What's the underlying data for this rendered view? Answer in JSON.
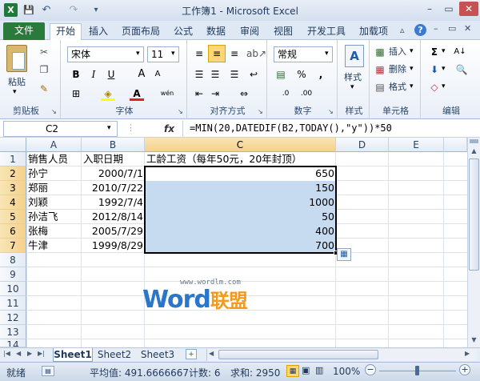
{
  "window": {
    "title": "工作簿1 - Microsoft Excel",
    "min": "–",
    "max": "▭",
    "close": "✕"
  },
  "qat": {
    "save": "💾",
    "undo": "↶",
    "redo": "↷",
    "more": "▾"
  },
  "tabs": {
    "file": "文件",
    "items": [
      "开始",
      "插入",
      "页面布局",
      "公式",
      "数据",
      "审阅",
      "视图",
      "开发工具",
      "加载项"
    ],
    "help": "?",
    "min_ribbon": "▵"
  },
  "ribbon": {
    "clipboard": {
      "label": "剪贴板",
      "paste": "粘贴"
    },
    "font": {
      "label": "字体",
      "name": "宋体",
      "size": "11",
      "bold": "B",
      "italic": "I",
      "underline": "U",
      "grow": "A",
      "shrink": "A",
      "wen": "wén"
    },
    "alignment": {
      "label": "对齐方式"
    },
    "number": {
      "label": "数字",
      "format": "常规",
      "percent": "%",
      "comma": ",",
      "currency": "⁰⁰",
      "inc": ".0",
      "dec": ".00"
    },
    "styles": {
      "label": "样式",
      "style": "样式"
    },
    "cells": {
      "label": "单元格",
      "insert": "插入",
      "delete": "删除",
      "format": "格式"
    },
    "editing": {
      "label": "编辑",
      "sum": "Σ",
      "sort": "A↓"
    }
  },
  "formula_bar": {
    "name_box": "C2",
    "fx": "fx",
    "formula": "=MIN(20,DATEDIF(B2,TODAY(),\"y\"))*50"
  },
  "columns": [
    "A",
    "B",
    "C",
    "D",
    "E"
  ],
  "rows": [
    "1",
    "2",
    "3",
    "4",
    "5",
    "6",
    "7",
    "8",
    "9",
    "10",
    "11",
    "12",
    "13",
    "14"
  ],
  "cells": {
    "r1": {
      "a": "销售人员",
      "b": "入职日期",
      "c": "工龄工资（每年50元，20年封顶）"
    },
    "data": [
      {
        "a": "孙宁",
        "b": "2000/7/1",
        "c": "650"
      },
      {
        "a": "郑丽",
        "b": "2010/7/22",
        "c": "150"
      },
      {
        "a": "刘颖",
        "b": "1992/7/4",
        "c": "1000"
      },
      {
        "a": "孙洁飞",
        "b": "2012/8/14",
        "c": "50"
      },
      {
        "a": "张梅",
        "b": "2005/7/29",
        "c": "400"
      },
      {
        "a": "牛津",
        "b": "1999/8/29",
        "c": "700"
      }
    ]
  },
  "watermark": {
    "site": "www.wordlm.com",
    "word": "Word",
    "cn": "联盟"
  },
  "sheets": [
    "Sheet1",
    "Sheet2",
    "Sheet3"
  ],
  "status": {
    "mode": "就绪",
    "average": "平均值: 491.6666667",
    "count": "计数: 6",
    "sum": "求和: 2950",
    "zoom": "100%"
  }
}
